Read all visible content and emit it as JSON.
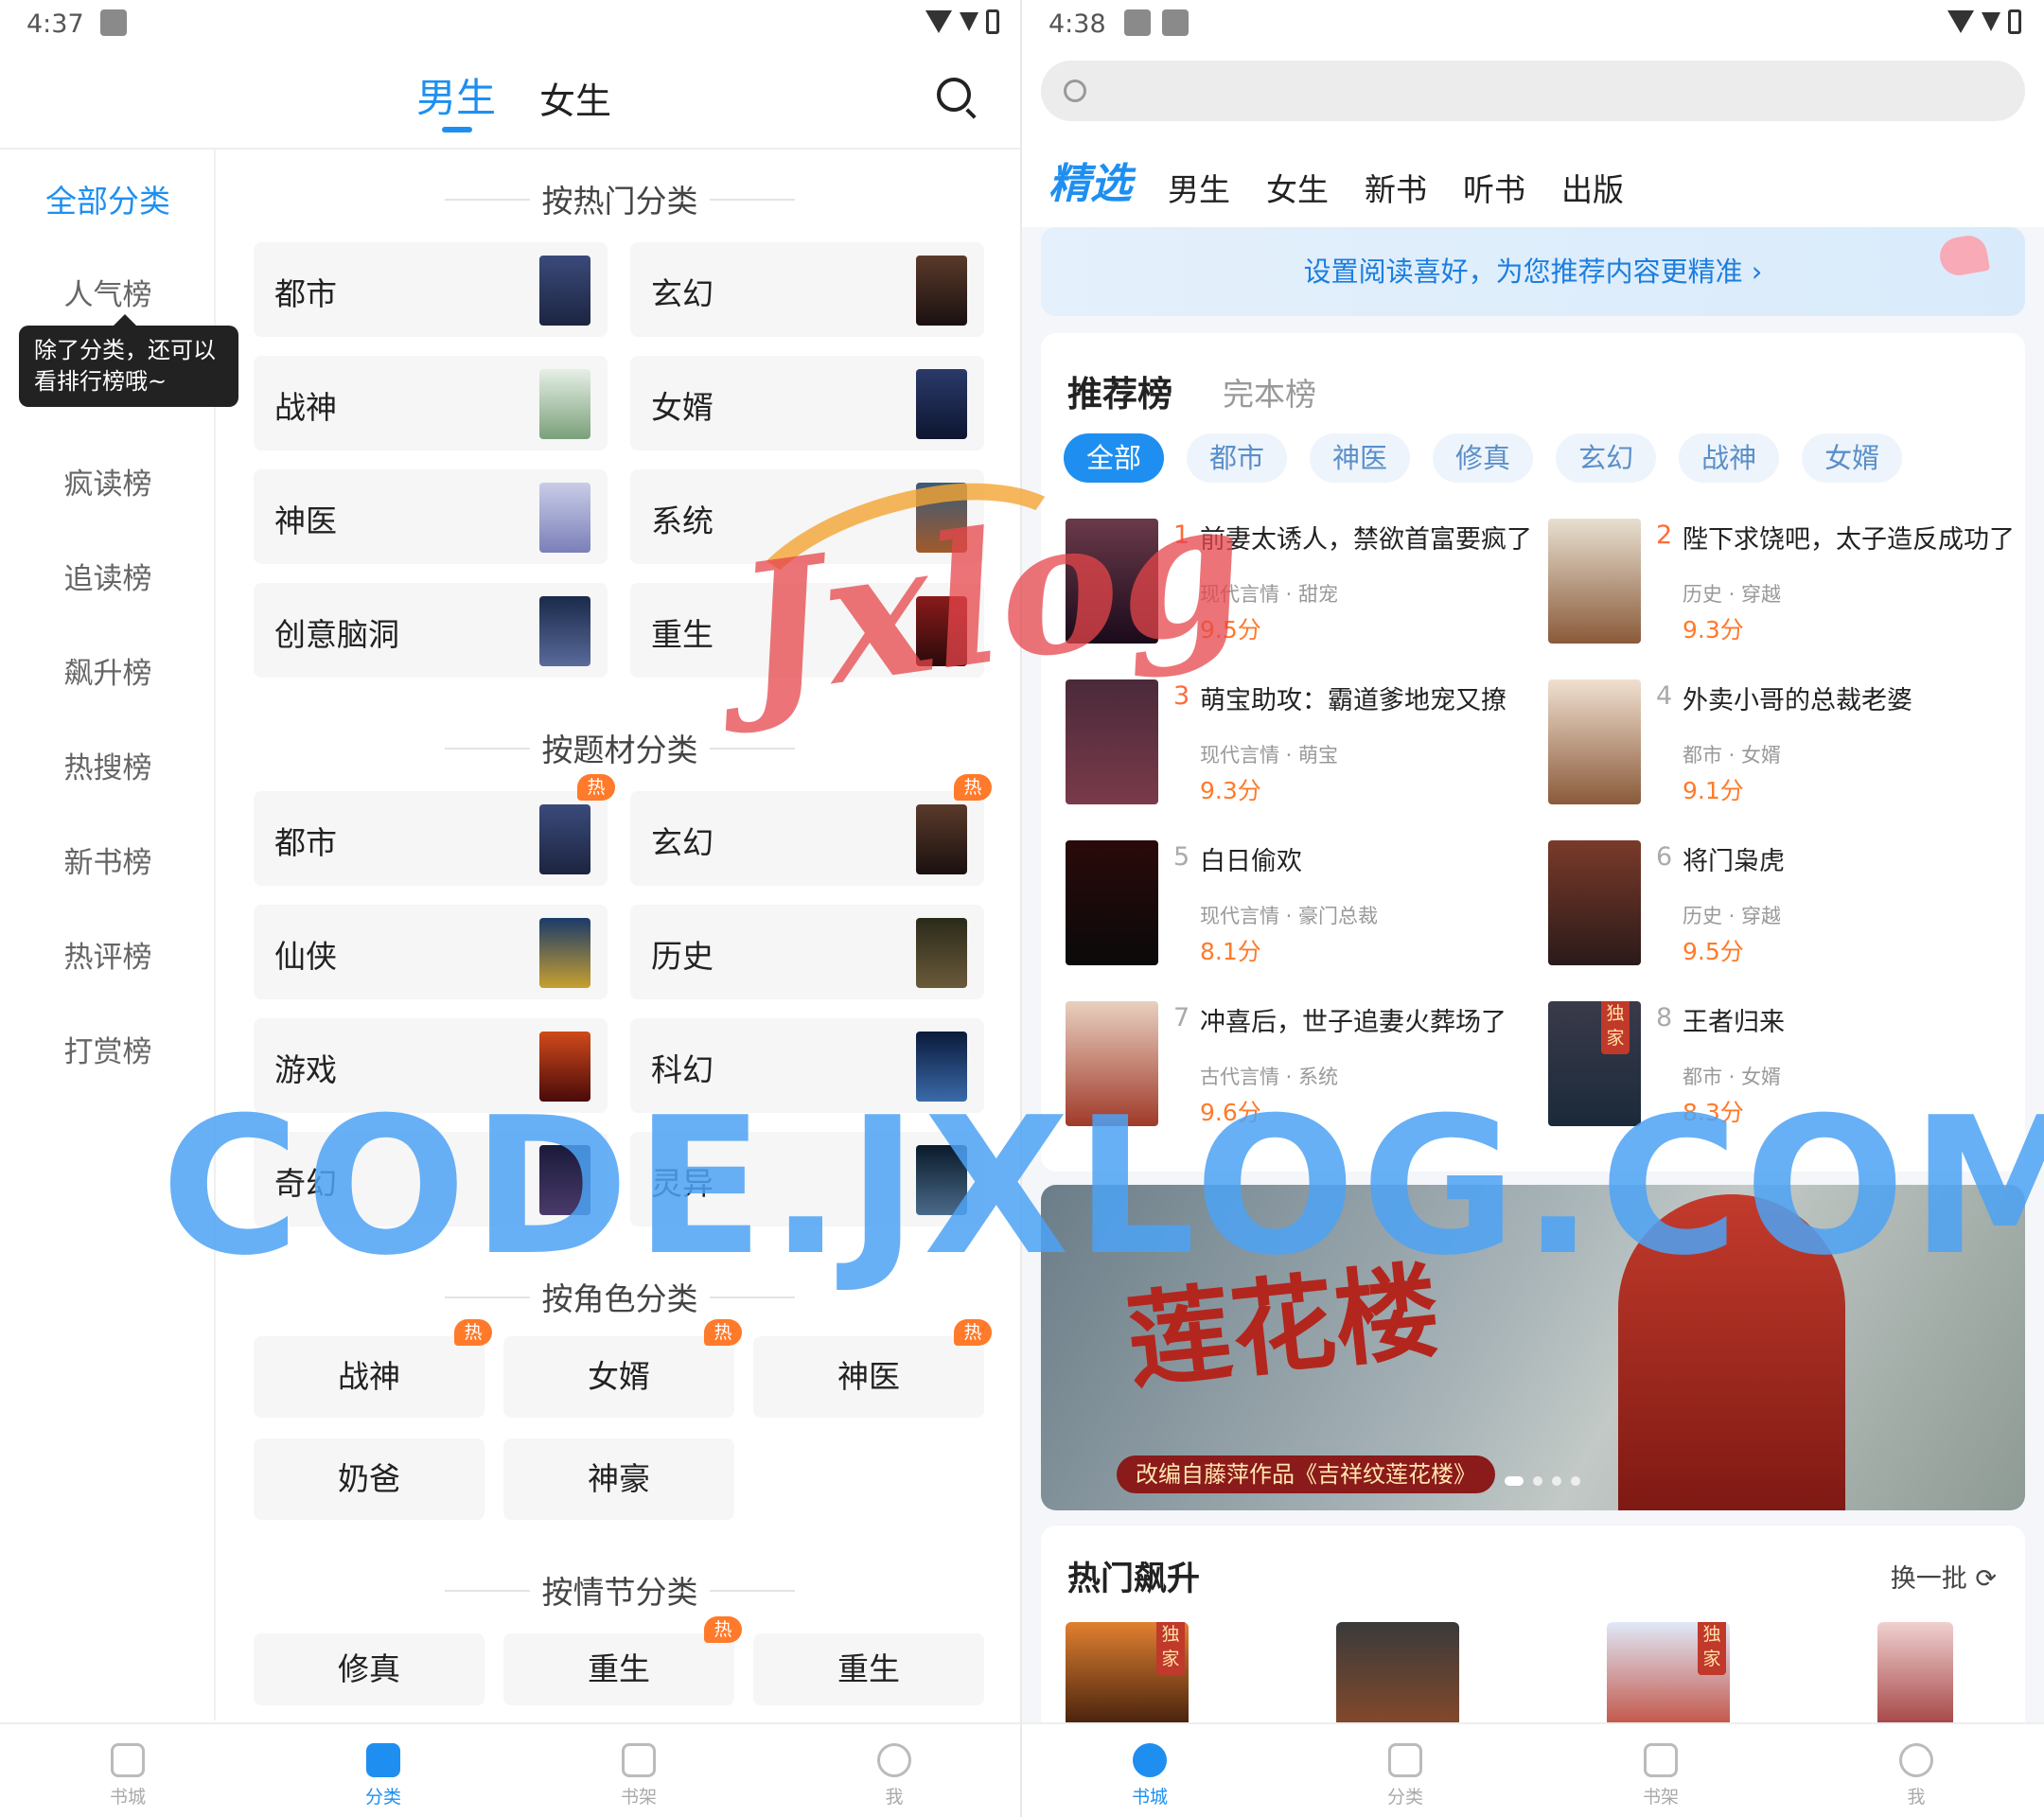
{
  "left": {
    "status": {
      "time": "4:37"
    },
    "gender_tabs": [
      "男生",
      "女生"
    ],
    "sidebar": [
      "全部分类",
      "人气榜",
      "疯读榜",
      "追读榜",
      "飙升榜",
      "热搜榜",
      "新书榜",
      "热评榜",
      "打赏榜"
    ],
    "tooltip": "除了分类，还可以看排行榜哦~",
    "sections": {
      "hot": "按热门分类",
      "subject": "按题材分类",
      "role": "按角色分类",
      "plot": "按情节分类"
    },
    "hot_cards": [
      "都市",
      "玄幻",
      "战神",
      "女婿",
      "神医",
      "系统",
      "创意脑洞",
      "重生"
    ],
    "subject_cards": [
      "都市",
      "玄幻",
      "仙侠",
      "历史",
      "游戏",
      "科幻",
      "奇幻",
      "灵异"
    ],
    "hot_badge": "热",
    "role_pills": [
      "战神",
      "女婿",
      "神医",
      "奶爸",
      "神豪"
    ],
    "plot_pills": [
      "修真",
      "重生",
      "重生"
    ],
    "nav": [
      "书城",
      "分类",
      "书架",
      "我"
    ]
  },
  "right": {
    "status": {
      "time": "4:38"
    },
    "tabs": [
      "精选",
      "男生",
      "女生",
      "新书",
      "听书",
      "出版"
    ],
    "pref_banner": "设置阅读喜好，为您推荐内容更精准 ›",
    "rank_title": "推荐榜",
    "rank_title2": "完本榜",
    "chips": [
      "全部",
      "都市",
      "神医",
      "修真",
      "玄幻",
      "战神",
      "女婿"
    ],
    "books": [
      {
        "rank": "1",
        "title": "前妻太诱人，禁欲首富要疯了",
        "meta": "现代言情 · 甜宠",
        "score": "9.5分"
      },
      {
        "rank": "2",
        "title": "陛下求饶吧，太子造反成功了",
        "meta": "历史 · 穿越",
        "score": "9.3分"
      },
      {
        "rank": "3",
        "title": "萌宝助攻：霸道爹地宠又撩",
        "meta": "现代言情 · 萌宝",
        "score": "9.3分"
      },
      {
        "rank": "4",
        "title": "外卖小哥的总裁老婆",
        "meta": "都市 · 女婿",
        "score": "9.1分"
      },
      {
        "rank": "5",
        "title": "白日偷欢",
        "meta": "现代言情 · 豪门总裁",
        "score": "8.1分"
      },
      {
        "rank": "6",
        "title": "将门枭虎",
        "meta": "历史 · 穿越",
        "score": "9.5分"
      },
      {
        "rank": "7",
        "title": "冲喜后，世子追妻火葬场了",
        "meta": "古代言情 · 系统",
        "score": "9.6分"
      },
      {
        "rank": "8",
        "title": "王者归来",
        "meta": "都市 · 女婿",
        "score": "8.3分"
      }
    ],
    "banner": {
      "title": "莲花楼",
      "caption": "改编自藤萍作品《吉祥纹莲花楼》"
    },
    "hot_rise": "热门飙升",
    "refresh": "换一批",
    "exclusive_tag": "独家",
    "nav": [
      "书城",
      "分类",
      "书架",
      "我"
    ]
  },
  "watermark": {
    "code": "CODE.JXLOG.COM",
    "jxlog": "Jxlog"
  },
  "colors": {
    "accent": "#1e8ff0",
    "hot": "#ff7a2a",
    "score": "#ff7a2a"
  }
}
